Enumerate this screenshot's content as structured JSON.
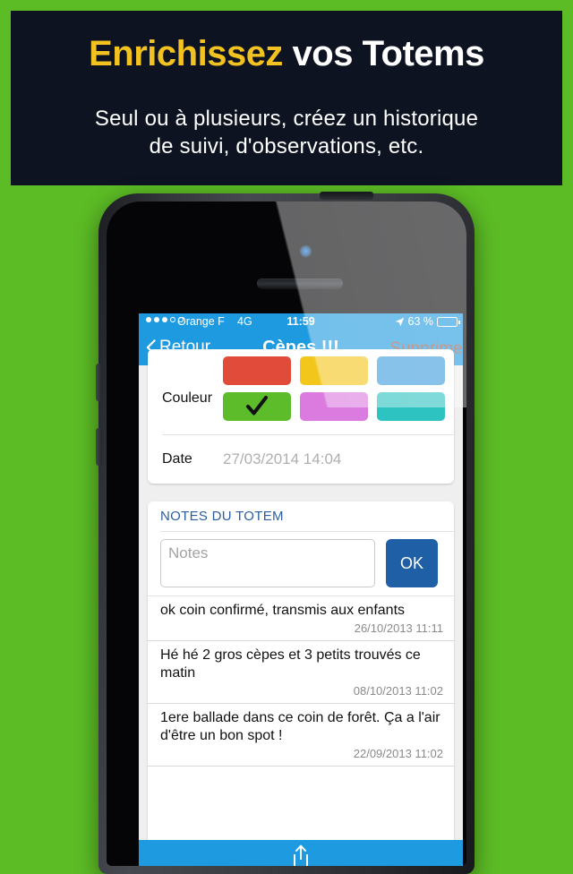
{
  "promo": {
    "title_highlight": "Enrichissez",
    "title_rest": " vos Totems",
    "subtitle_line1": "Seul ou à plusieurs, créez un historique",
    "subtitle_line2": "de suivi, d'observations, etc.",
    "band_color": "#0D1320",
    "highlight_color": "#F2C220",
    "background_color": "#5CBC25"
  },
  "status_bar": {
    "signal_dots_filled": 3,
    "signal_dots_total": 5,
    "carrier": "Orange F",
    "network": "4G",
    "time": "11:59",
    "location_icon": "location-arrow-icon",
    "battery_percent": "63 %",
    "battery_level": 63,
    "bar_color": "#1E9AE0"
  },
  "nav_bar": {
    "back_icon": "chevron-left-icon",
    "back_label": "Retour",
    "title": "Cèpes !!!",
    "delete_label": "Supprimer",
    "delete_color": "#A8563F"
  },
  "properties_card": {
    "color_label": "Couleur",
    "swatches": [
      {
        "name": "red",
        "hex": "#E04B3A",
        "selected": false
      },
      {
        "name": "yellow",
        "hex": "#F3C61C",
        "selected": false
      },
      {
        "name": "blue",
        "hex": "#3B9BDC",
        "selected": false
      },
      {
        "name": "green",
        "hex": "#5CBC2A",
        "selected": true
      },
      {
        "name": "magenta",
        "hex": "#DB7BE0",
        "selected": false
      },
      {
        "name": "teal",
        "hex": "#2DC3C0",
        "selected": false
      }
    ],
    "date_label": "Date",
    "date_value": "27/03/2014 14:04"
  },
  "notes_card": {
    "section_title": "NOTES DU TOTEM",
    "input_placeholder": "Notes",
    "input_value": "",
    "ok_label": "OK",
    "ok_color": "#1F5FA5",
    "items": [
      {
        "text": "ok coin confirmé, transmis aux enfants",
        "date": "26/10/2013 11:11"
      },
      {
        "text": "Hé hé 2 gros cèpes et 3 petits trouvés ce matin",
        "date": "08/10/2013 11:02"
      },
      {
        "text": "1ere ballade dans ce coin de forêt. Ça a l'air d'être un bon spot !",
        "date": "22/09/2013 11:02"
      }
    ]
  },
  "toolbar": {
    "share_icon": "share-icon",
    "color": "#1E9AE0"
  }
}
